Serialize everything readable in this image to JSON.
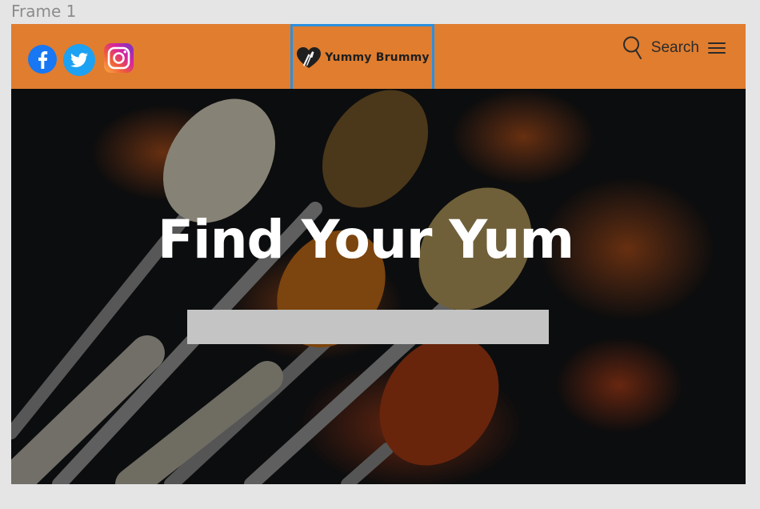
{
  "frame_label": "Frame 1",
  "header": {
    "background_color": "#e07d2f",
    "social_icons": [
      "facebook-icon",
      "twitter-icon",
      "instagram-icon"
    ],
    "logo": {
      "text": "Yummy Brummy",
      "icon": "heart-fork-knife-icon",
      "selection_border_color": "#2c8fdf"
    },
    "search_label": "Search",
    "menu_icon": "hamburger-menu-icon"
  },
  "hero": {
    "title": "Find Your Yum",
    "background": "spices on spoons photo",
    "search_input": {
      "value": "",
      "placeholder": "",
      "color": "#c4c4c4"
    }
  }
}
